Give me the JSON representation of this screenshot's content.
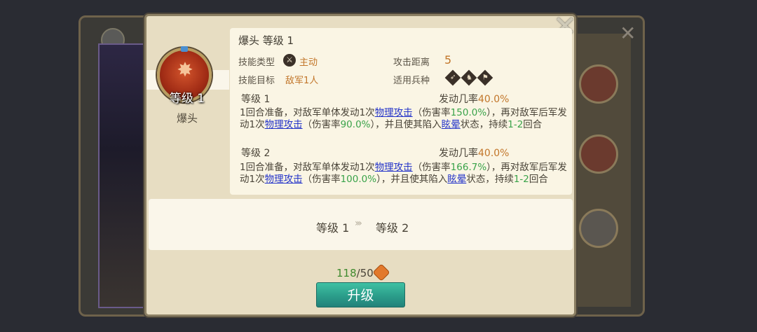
{
  "skill": {
    "title": "爆头 等级 1",
    "emblem_level": "等级 1",
    "name": "爆头",
    "type_label": "技能类型",
    "type_value": "主动",
    "range_label": "攻击距离",
    "range_value": "5",
    "target_label": "技能目标",
    "target_value": "敌军1人",
    "units_label": "适用兵种"
  },
  "levels": [
    {
      "header": "等级 1",
      "rate_label": "发动几率",
      "rate_value": "40.0%",
      "desc": {
        "p1": "1回合准备，对敌军单体发动1次",
        "link1": "物理攻击",
        "p2": "（伤害率",
        "n1": "150.0%",
        "p3": "），再对敌军后军发动1次",
        "link2": "物理攻击",
        "p4": "（伤害率",
        "n2": "90.0%",
        "p5": "），并且使其陷入",
        "link3": "眩晕",
        "p6": "状态，持续",
        "n3": "1-2",
        "p7": "回合"
      }
    },
    {
      "header": "等级 2",
      "rate_label": "发动几率",
      "rate_value": "40.0%",
      "desc": {
        "p1": "1回合准备，对敌军单体发动1次",
        "link1": "物理攻击",
        "p2": "（伤害率",
        "n1": "166.7%",
        "p3": "），再对敌军后军发动1次",
        "link2": "物理攻击",
        "p4": "（伤害率",
        "n2": "100.0%",
        "p5": "），并且使其陷入",
        "link3": "眩晕",
        "p6": "状态，持续",
        "n3": "1-2",
        "p7": "回合"
      }
    }
  ],
  "upgrade": {
    "from": "等级 1",
    "arrows": "›››",
    "to": "等级 2",
    "cost_have": "118",
    "cost_sep": "/",
    "cost_need": "50",
    "button": "升级"
  },
  "icons": {
    "close": "close-icon",
    "skill_type": "active-skill-icon",
    "gem": "upgrade-gem-icon"
  },
  "colors": {
    "orange_value": "#c2762a",
    "green_number": "#3aa34a",
    "link_blue": "#2333c9",
    "button_teal": "#2b9d8a"
  }
}
